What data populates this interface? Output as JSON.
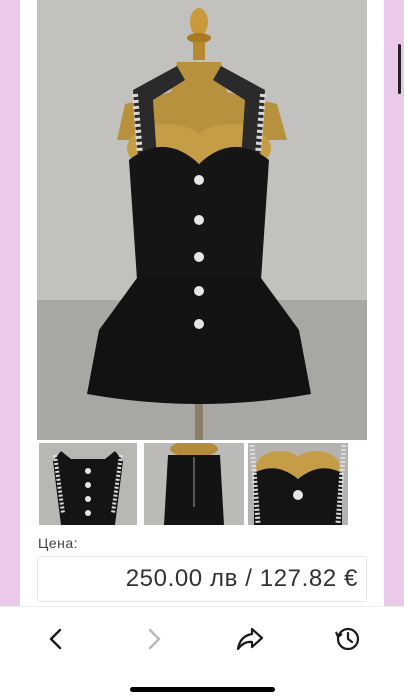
{
  "product": {
    "main_image": "black-dress-on-mannequin",
    "thumbnails": [
      "dress-front-view",
      "dress-back-view",
      "dress-bodice-closeup"
    ]
  },
  "price": {
    "label": "Цена:",
    "value": "250.00 лв / 127.82 €"
  },
  "toolbar": {
    "back_icon": "chevron-left-icon",
    "forward_icon": "chevron-right-icon",
    "share_icon": "share-arrow-icon",
    "history_icon": "history-clock-icon"
  },
  "colors": {
    "side_stripe": "#ebc9e8",
    "dress": "#121212",
    "mannequin": "#b0893f"
  }
}
